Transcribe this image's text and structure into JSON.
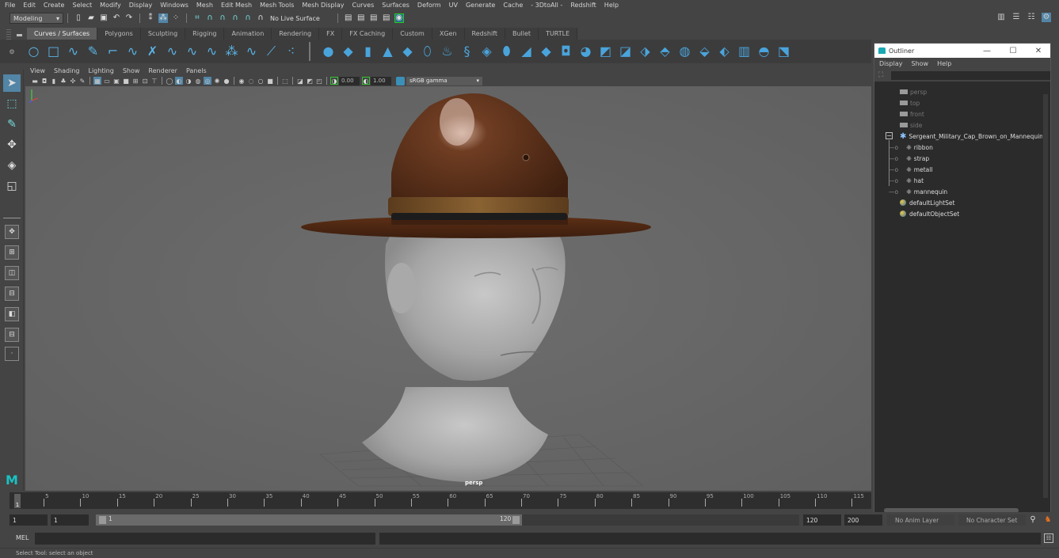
{
  "menubar": {
    "items": [
      "File",
      "Edit",
      "Create",
      "Select",
      "Modify",
      "Display",
      "Windows",
      "Mesh",
      "Edit Mesh",
      "Mesh Tools",
      "Mesh Display",
      "Curves",
      "Surfaces",
      "Deform",
      "UV",
      "Generate",
      "Cache",
      "- 3DtoAll -",
      "Redshift",
      "Help"
    ]
  },
  "statusline": {
    "mode": "Modeling",
    "live_surface": "No Live Surface",
    "icons": [
      "new-scene-icon",
      "open-scene-icon",
      "save-scene-icon",
      "undo-icon",
      "redo-icon",
      "select-hierarchy-icon",
      "select-object-icon",
      "select-component-icon",
      "snap-grid-icon",
      "snap-curve-icon",
      "snap-point-icon",
      "snap-view-plane-icon",
      "snap-live-icon",
      "make-live-icon",
      "render-view-icon",
      "render-frame-icon",
      "ipr-render-icon",
      "render-settings-icon",
      "hypershade-icon"
    ],
    "right_icons": [
      "modeling-toolkit-icon",
      "channel-box-icon",
      "attribute-editor-icon",
      "tool-settings-icon"
    ]
  },
  "shelf": {
    "tabs": [
      "Curves / Surfaces",
      "Polygons",
      "Sculpting",
      "Rigging",
      "Animation",
      "Rendering",
      "FX",
      "FX Caching",
      "Custom",
      "XGen",
      "Redshift",
      "Bullet",
      "TURTLE"
    ],
    "active_tab": "Curves / Surfaces",
    "curve_tools": [
      "○",
      "□",
      "∿",
      "✎",
      "⌐",
      "∿",
      "✗",
      "∿",
      "∿",
      "∿",
      "⁂",
      "∿",
      "⟋",
      "⁖"
    ],
    "surface_tools": [
      "●",
      "◆",
      "▮",
      "▲",
      "◆",
      "⬯",
      "♨",
      "§",
      "◈",
      "⬮",
      "◢",
      "◆",
      "◘",
      "◕",
      "◩",
      "◪",
      "⬗",
      "⬘",
      "◍",
      "⬙",
      "⬖",
      "▥",
      "◓",
      "⬔"
    ]
  },
  "toolbox": {
    "tools": [
      "select-tool",
      "lasso-tool",
      "paint-select-tool",
      "move-tool",
      "rotate-tool",
      "scale-tool"
    ],
    "layouts": [
      "single-pane-layout",
      "four-pane-layout",
      "two-pane-side-layout",
      "two-pane-stacked-layout",
      "three-pane-layout",
      "outliner-persp-layout",
      "custom-layout"
    ]
  },
  "viewport": {
    "menu": [
      "View",
      "Shading",
      "Lighting",
      "Show",
      "Renderer",
      "Panels"
    ],
    "exposure": "0.00",
    "gamma": "1.00",
    "color_space": "sRGB gamma",
    "camera_label": "persp"
  },
  "outliner": {
    "title": "Outliner",
    "menu": [
      "Display",
      "Show",
      "Help"
    ],
    "search_value": "",
    "items": [
      {
        "label": "persp",
        "type": "camera",
        "dim": true
      },
      {
        "label": "top",
        "type": "camera",
        "dim": true
      },
      {
        "label": "front",
        "type": "camera",
        "dim": true
      },
      {
        "label": "side",
        "type": "camera",
        "dim": true
      },
      {
        "label": "Sergeant_Military_Cap_Brown_on_Mannequin_",
        "type": "group",
        "expanded": true
      },
      {
        "label": "ribbon",
        "type": "mesh",
        "child": true
      },
      {
        "label": "strap",
        "type": "mesh",
        "child": true
      },
      {
        "label": "metall",
        "type": "mesh",
        "child": true
      },
      {
        "label": "hat",
        "type": "mesh",
        "child": true
      },
      {
        "label": "mannequin",
        "type": "mesh",
        "child": true
      },
      {
        "label": "defaultLightSet",
        "type": "set"
      },
      {
        "label": "defaultObjectSet",
        "type": "set"
      }
    ]
  },
  "timeslider": {
    "current_frame": "1",
    "ticks": [
      5,
      10,
      15,
      20,
      25,
      30,
      35,
      40,
      45,
      50,
      55,
      60,
      65,
      70,
      75,
      80,
      85,
      90,
      95,
      100,
      105,
      110,
      115
    ],
    "visible_start": 1,
    "visible_end": 117
  },
  "range": {
    "start_time": "1",
    "playback_start": "1",
    "range_start_label": "1",
    "range_end_label": "120",
    "playback_end": "120",
    "end_time": "200",
    "anim_layer": "No Anim Layer",
    "character_set": "No Character Set"
  },
  "cmdline": {
    "label": "MEL",
    "input_value": ""
  },
  "helpline": {
    "text": "Select Tool: select an object"
  }
}
